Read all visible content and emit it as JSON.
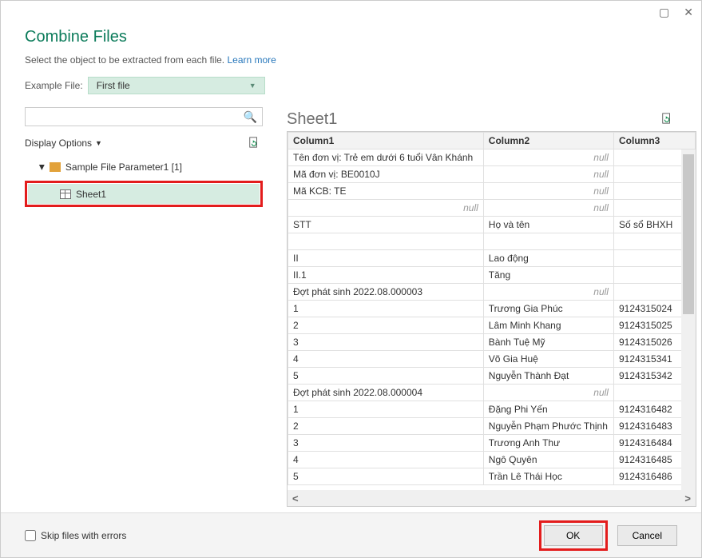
{
  "titlebar": {
    "maximize_tip": "Maximize",
    "close_tip": "Close"
  },
  "header": {
    "title": "Combine Files",
    "subtitle_text": "Select the object to be extracted from each file.",
    "learn_more": "Learn more",
    "example_label": "Example File:",
    "example_value": "First file"
  },
  "left": {
    "search_placeholder": "",
    "display_options": "Display Options",
    "tree_node": "Sample File Parameter1 [1]",
    "sheet_item": "Sheet1"
  },
  "preview": {
    "sheet_title": "Sheet1",
    "columns": [
      "Column1",
      "Column2",
      "Column3"
    ],
    "rows": [
      [
        "Tên đơn vị: Trẻ em dưới 6 tuổi Vân Khánh",
        null,
        ""
      ],
      [
        "Mã đơn vị: BE0010J",
        null,
        ""
      ],
      [
        "Mã KCB: TE",
        null,
        ""
      ],
      [
        null,
        null,
        ""
      ],
      [
        "STT",
        "Họ và tên",
        "Số sổ BHXH"
      ],
      [
        "",
        "",
        ""
      ],
      [
        "II",
        "Lao động",
        ""
      ],
      [
        "II.1",
        "Tăng",
        ""
      ],
      [
        "Đợt phát sinh 2022.08.000003",
        null,
        ""
      ],
      [
        "1",
        "Trương Gia Phúc",
        "9124315024"
      ],
      [
        "2",
        "Lâm Minh Khang",
        "9124315025"
      ],
      [
        "3",
        "Bành Tuệ Mỹ",
        "9124315026"
      ],
      [
        "4",
        "Võ Gia Huệ",
        "9124315341"
      ],
      [
        "5",
        "Nguyễn Thành Đạt",
        "9124315342"
      ],
      [
        "Đợt phát sinh 2022.08.000004",
        null,
        ""
      ],
      [
        "1",
        "Đặng Phi Yến",
        "9124316482"
      ],
      [
        "2",
        "Nguyễn Phạm Phước Thịnh",
        "9124316483"
      ],
      [
        "3",
        "Trương Anh Thư",
        "9124316484"
      ],
      [
        "4",
        "Ngô Quyên",
        "9124316485"
      ],
      [
        "5",
        "Trần Lê Thái Học",
        "9124316486"
      ]
    ]
  },
  "footer": {
    "skip_label": "Skip files with errors",
    "ok": "OK",
    "cancel": "Cancel"
  }
}
